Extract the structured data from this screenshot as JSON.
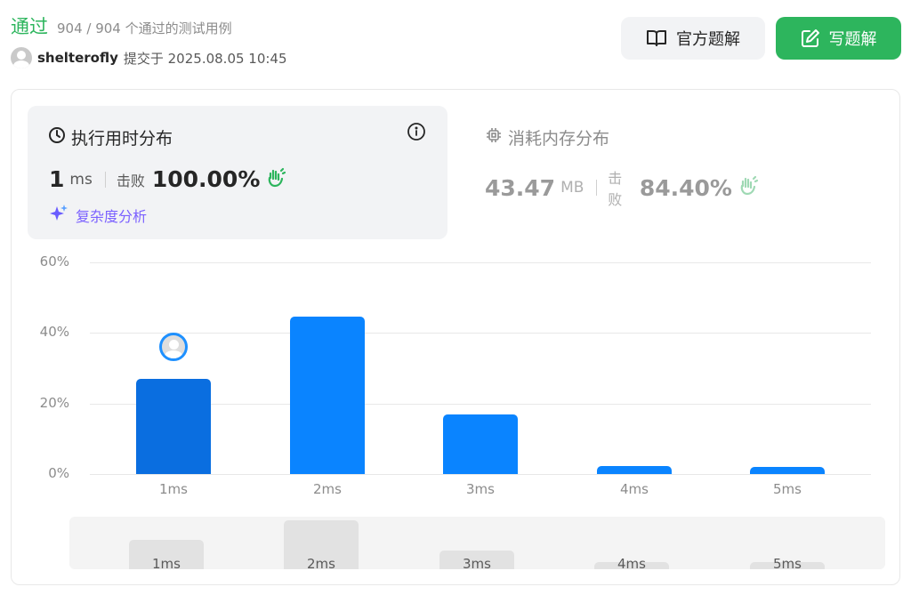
{
  "header": {
    "status": "通过",
    "testcases": "904 / 904 个通过的测试用例",
    "username": "shelterofly",
    "submitted": "提交于 2025.08.05 10:45"
  },
  "buttons": {
    "official": "官方题解",
    "write": "写题解"
  },
  "runtime": {
    "title": "执行用时分布",
    "value": "1",
    "unit": "ms",
    "beat_label": "击败",
    "beat_value": "100.00%",
    "complexity_label": "复杂度分析"
  },
  "memory": {
    "title": "消耗内存分布",
    "value": "43.47",
    "unit": "MB",
    "beat_label": "击败",
    "beat_value": "84.40%"
  },
  "colors": {
    "accepted": "#2db55d",
    "bar": "#0a84ff",
    "bar_active": "#0a6ee0",
    "complexity": "#7b61ff"
  },
  "chart_data": {
    "type": "bar",
    "categories": [
      "1ms",
      "2ms",
      "3ms",
      "4ms",
      "5ms"
    ],
    "values": [
      27,
      44.5,
      17,
      2.2,
      1.9
    ],
    "y_ticks": [
      "60%",
      "40%",
      "20%",
      "0%"
    ],
    "ylim": [
      0,
      60
    ],
    "highlight_category": "1ms",
    "grid": true
  },
  "overview": {
    "categories": [
      "1ms",
      "2ms",
      "3ms",
      "4ms",
      "5ms"
    ],
    "values": [
      27,
      44.5,
      17,
      2.2,
      1.9
    ]
  }
}
